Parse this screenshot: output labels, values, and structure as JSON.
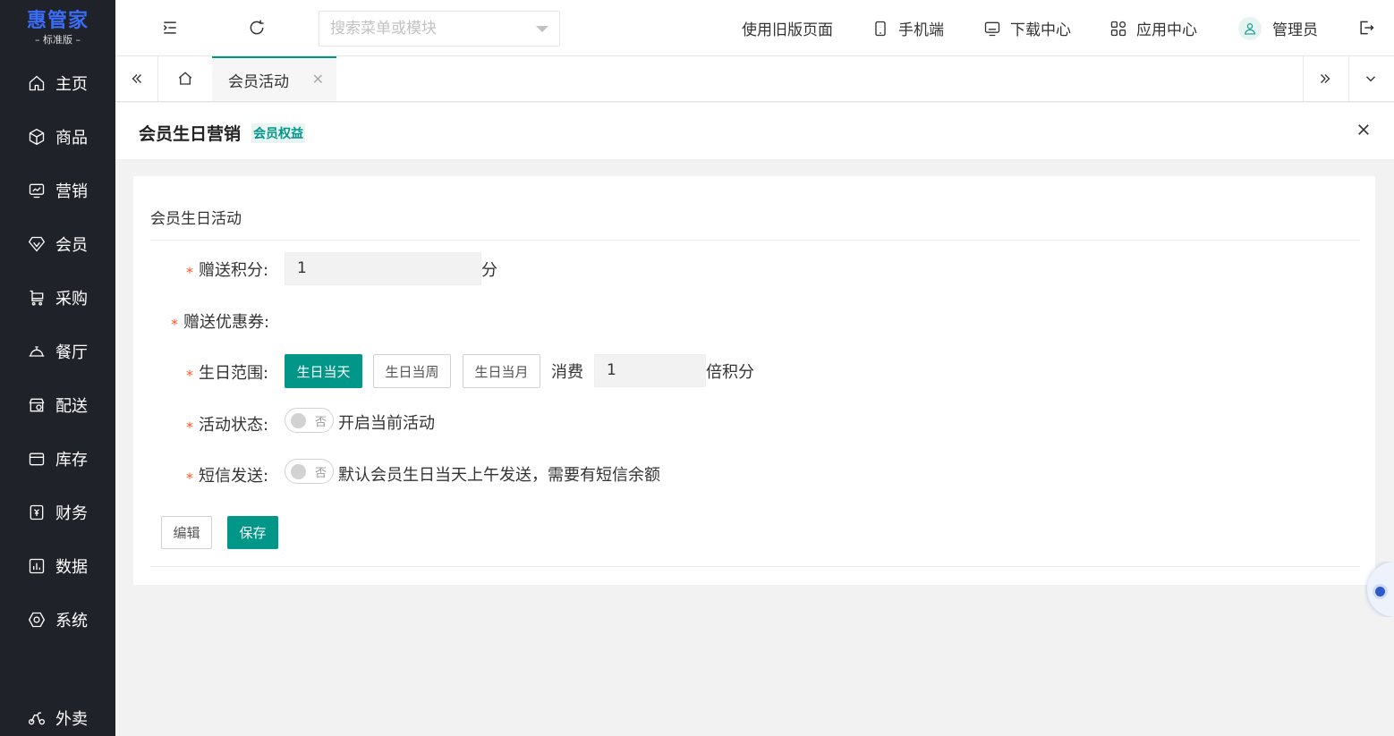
{
  "brand": {
    "name": "惠管家",
    "edition": "– 标准版 –"
  },
  "sidebar": {
    "items": [
      {
        "label": "主页",
        "icon": "home-icon"
      },
      {
        "label": "商品",
        "icon": "cube-icon"
      },
      {
        "label": "营销",
        "icon": "chart-board-icon"
      },
      {
        "label": "会员",
        "icon": "diamond-icon"
      },
      {
        "label": "采购",
        "icon": "cart-icon"
      },
      {
        "label": "餐厅",
        "icon": "cloche-icon"
      },
      {
        "label": "配送",
        "icon": "delivery-icon"
      },
      {
        "label": "库存",
        "icon": "warehouse-icon"
      },
      {
        "label": "财务",
        "icon": "yuan-icon"
      },
      {
        "label": "数据",
        "icon": "bar-chart-icon"
      },
      {
        "label": "系统",
        "icon": "settings-icon"
      },
      {
        "label": "外卖",
        "icon": "scooter-icon"
      }
    ]
  },
  "header": {
    "search_placeholder": "搜索菜单或模块",
    "old_version": "使用旧版页面",
    "mobile": "手机端",
    "download_center": "下载中心",
    "app_center": "应用中心",
    "user": "管理员"
  },
  "tabs": [
    {
      "label": "会员活动",
      "active": true
    }
  ],
  "page": {
    "title": "会员生日营销",
    "tag": "会员权益"
  },
  "form": {
    "section_title": "会员生日活动",
    "points_label": "赠送积分:",
    "points_value": "1",
    "points_unit": "分",
    "coupon_label": "赠送优惠券:",
    "range_label": "生日范围:",
    "range_options": [
      "生日当天",
      "生日当周",
      "生日当月"
    ],
    "range_selected": "生日当天",
    "consume_label": "消费",
    "multiplier_value": "1",
    "multiplier_unit": "倍积分",
    "status_label": "活动状态:",
    "status_switch_text": "否",
    "status_hint": "开启当前活动",
    "sms_label": "短信发送:",
    "sms_switch_text": "否",
    "sms_hint": "默认会员生日当天上午发送，需要有短信余额",
    "edit_button": "编辑",
    "save_button": "保存"
  },
  "colors": {
    "primary": "#009688",
    "sidebar_bg": "#20222a",
    "brand": "#3a6cf5",
    "required": "#ff5722"
  }
}
